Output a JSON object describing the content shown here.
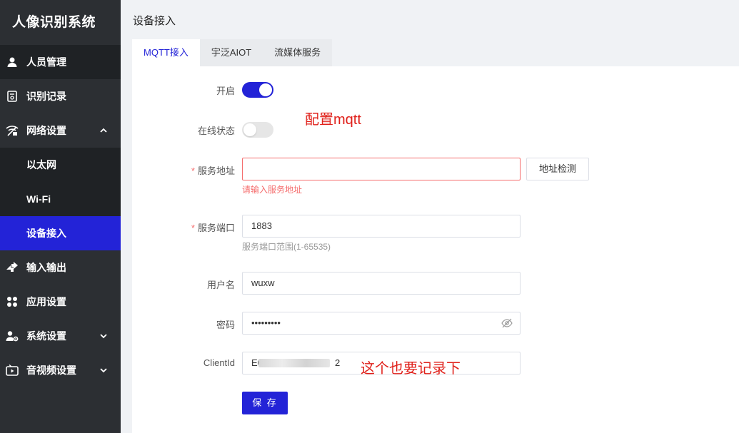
{
  "app": {
    "title": "人像识别系统"
  },
  "sidebar": {
    "items": [
      {
        "label": "人员管理"
      },
      {
        "label": "识别记录"
      },
      {
        "label": "网络设置"
      },
      {
        "label": "以太网"
      },
      {
        "label": "Wi-Fi"
      },
      {
        "label": "设备接入"
      },
      {
        "label": "输入输出"
      },
      {
        "label": "应用设置"
      },
      {
        "label": "系统设置"
      },
      {
        "label": "音视频设置"
      }
    ],
    "active_item": "设备接入"
  },
  "page": {
    "title": "设备接入"
  },
  "tabs": [
    {
      "label": "MQTT接入",
      "active": true
    },
    {
      "label": "宇泛AIOT",
      "active": false
    },
    {
      "label": "流媒体服务",
      "active": false
    }
  ],
  "form": {
    "enable": {
      "label": "开启",
      "on": true
    },
    "online_status": {
      "label": "在线状态",
      "on": false
    },
    "server_address": {
      "label": "服务地址",
      "value": "",
      "error": "请输入服务地址"
    },
    "check_button": "地址检测",
    "server_port": {
      "label": "服务端口",
      "value": "1883",
      "hint": "服务端口范围(1-65535)"
    },
    "username": {
      "label": "用户名",
      "value": "wuxw"
    },
    "password": {
      "label": "密码",
      "value": "•••••••••"
    },
    "client_id": {
      "label": "ClientId",
      "prefix": "E0",
      "suffix": "2"
    },
    "save_button": "保 存",
    "required_mark": "*"
  },
  "annotations": {
    "mqtt_note": "配置mqtt",
    "record_note": "这个也要记录下"
  },
  "colors": {
    "accent": "#2323d7",
    "sidebar_bg": "#2c2f33",
    "error": "#f56c6c",
    "annotation": "#e0201a"
  }
}
